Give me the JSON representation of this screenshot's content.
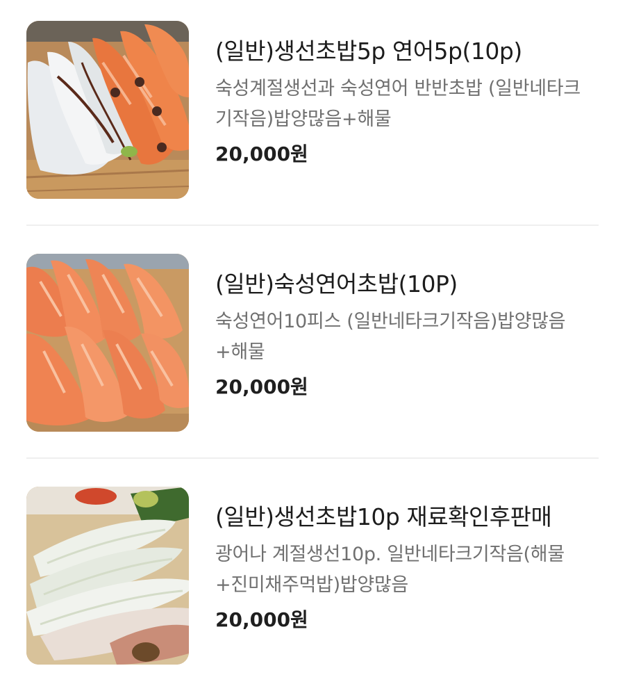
{
  "items": [
    {
      "name": "(일반)생선초밥5p 연어5p(10p)",
      "description": "숙성계절생선과 숙성연어 반반초밥 (일반네타크기작음)밥양많음+해물",
      "price": "20,000원",
      "image": "sushi-mixed-fish-salmon-photo"
    },
    {
      "name": "(일반)숙성연어초밥(10P)",
      "description": "숙성연어10피스 (일반네타크기작음)밥양많음 +해물",
      "price": "20,000원",
      "image": "sushi-salmon-photo"
    },
    {
      "name": "(일반)생선초밥10p 재료확인후판매",
      "description": "광어나 계절생선10p. 일반네타크기작음(해물+진미채주먹밥)밥양많음",
      "price": "20,000원",
      "image": "sushi-white-fish-photo"
    }
  ]
}
